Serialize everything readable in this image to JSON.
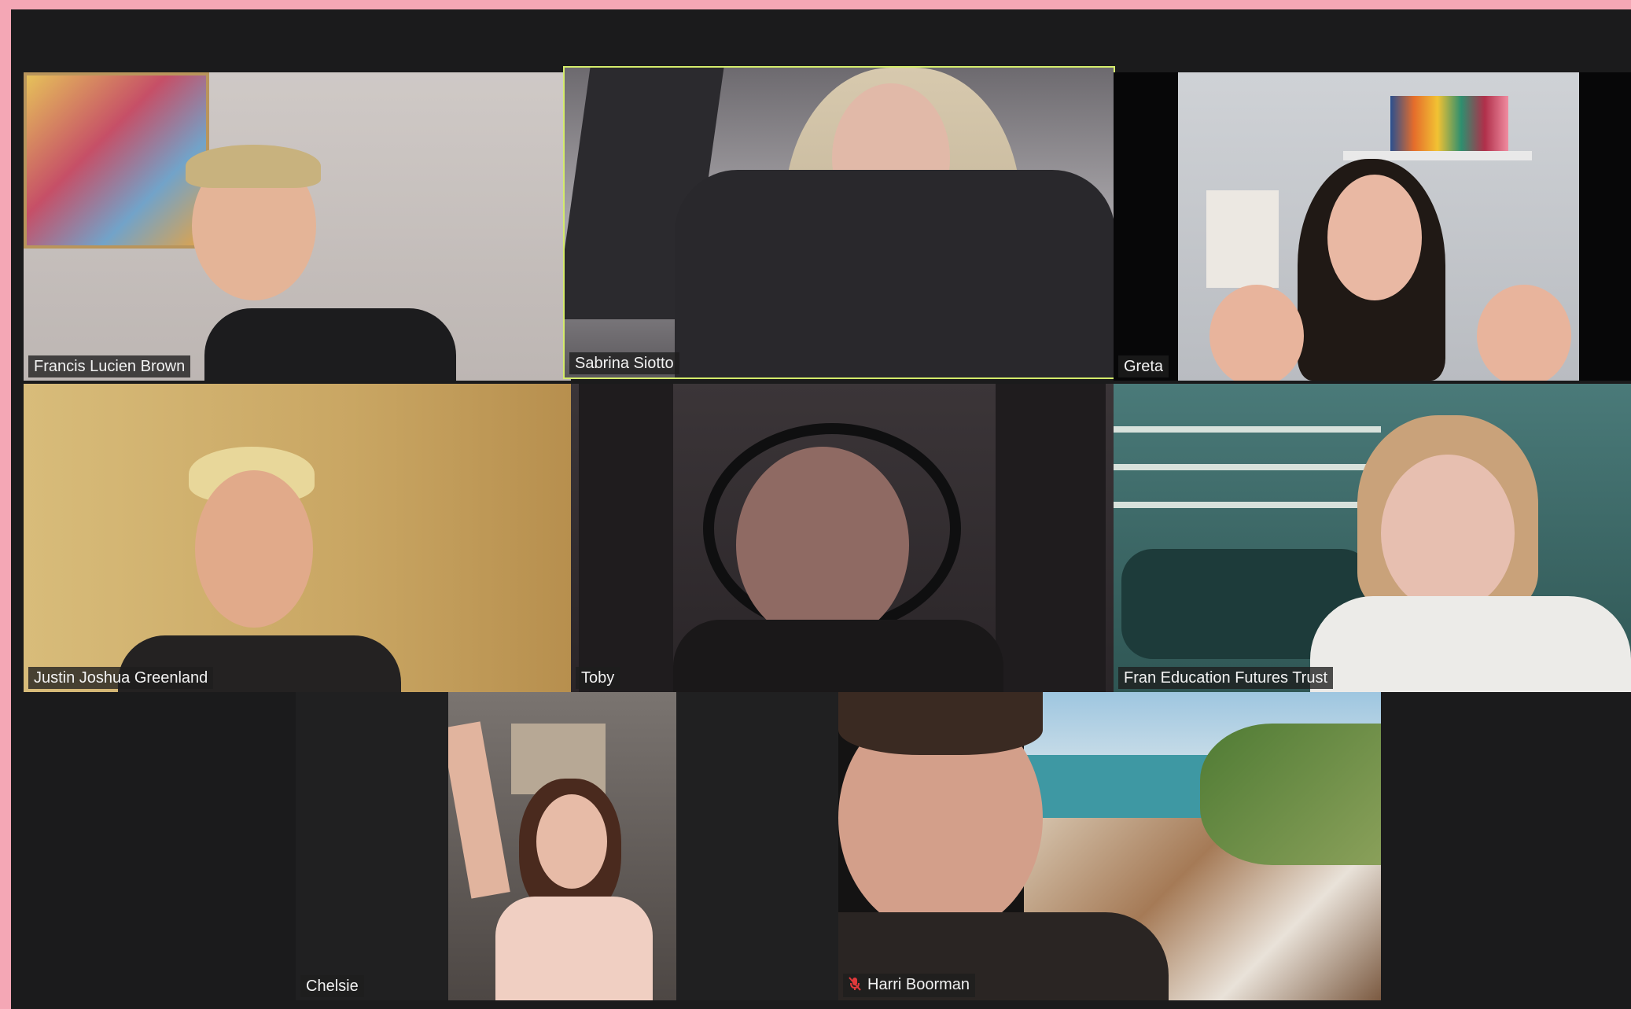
{
  "app": {
    "window_title": "",
    "layout": "gallery-view"
  },
  "colors": {
    "page_frame": "#f4a7b5",
    "window_bg": "#1b1b1c",
    "tile_bg": "#202021",
    "active_speaker_border": "#d4ec6b",
    "label_bg": "#1e1e1e",
    "label_text": "#f2f2f2",
    "muted_icon": "#e0393b"
  },
  "participants": [
    {
      "name": "Francis Lucien Brown",
      "muted": false,
      "active_speaker": false
    },
    {
      "name": "Sabrina Siotto",
      "muted": false,
      "active_speaker": true
    },
    {
      "name": "Greta",
      "muted": false,
      "active_speaker": false
    },
    {
      "name": "Justin Joshua Greenland",
      "muted": false,
      "active_speaker": false
    },
    {
      "name": "Toby",
      "muted": false,
      "active_speaker": false
    },
    {
      "name": "Fran Education Futures Trust",
      "muted": false,
      "active_speaker": false
    },
    {
      "name": "Chelsie",
      "muted": false,
      "active_speaker": false
    },
    {
      "name": "Harri Boorman",
      "muted": true,
      "active_speaker": false,
      "icon": "microphone-muted-icon"
    }
  ]
}
